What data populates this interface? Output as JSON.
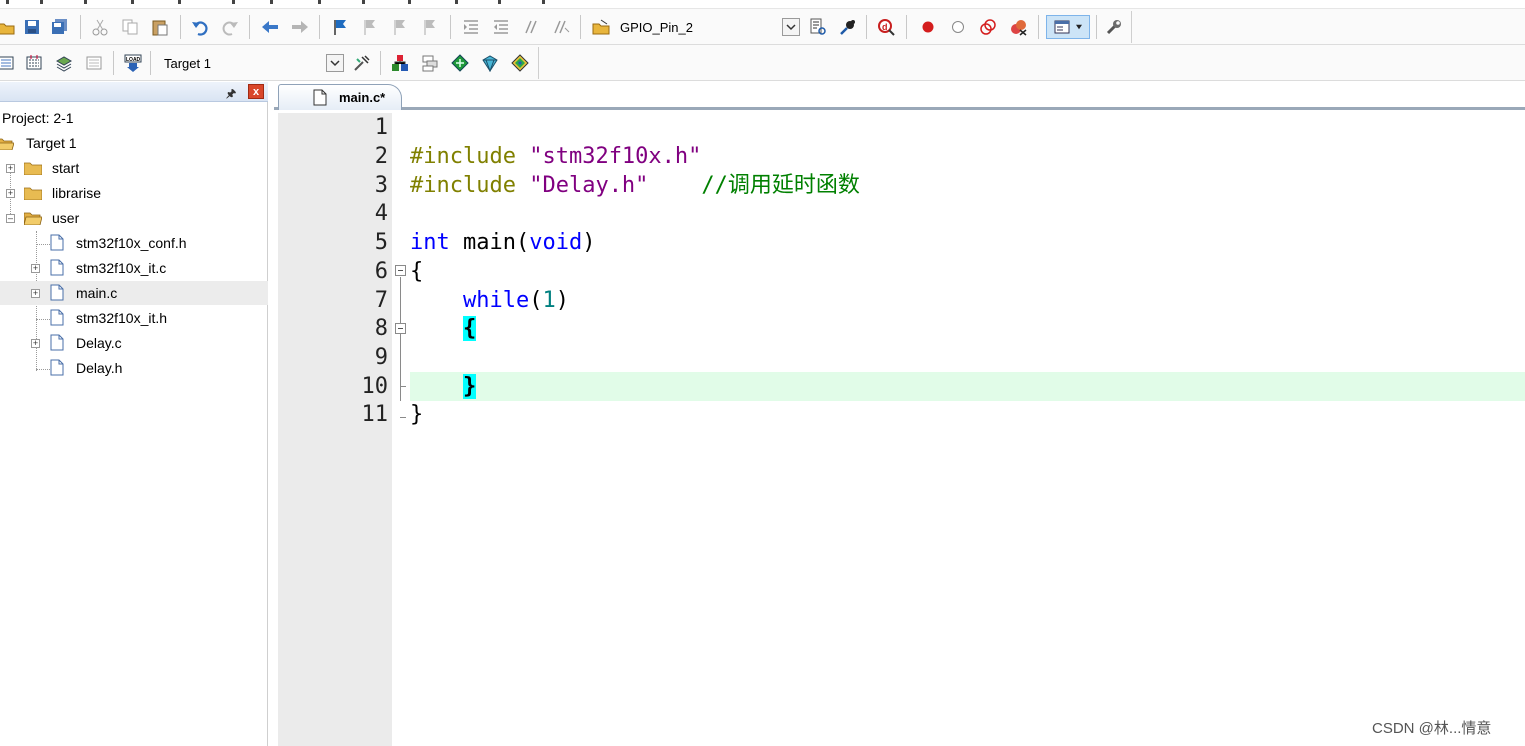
{
  "toolbar1": {
    "target_combo_value": "GPIO_Pin_2",
    "icons": [
      "open-icon",
      "save-icon",
      "save-all-icon",
      "cut-icon",
      "copy-icon",
      "paste-icon",
      "undo-icon",
      "redo-icon",
      "nav-back-icon",
      "nav-forward-icon",
      "bookmark-icon",
      "bookmark-prev-icon",
      "bookmark-next-icon",
      "bookmark-clear-icon",
      "indent-icon",
      "unindent-icon",
      "comment-icon",
      "uncomment-icon",
      "find-in-files-icon",
      "find-icon",
      "incremental-find-icon",
      "debug-icon",
      "breakpoint-icon",
      "breakpoint-disable-icon",
      "breakpoint-disable-all-icon",
      "breakpoint-kill-icon",
      "window-layout-icon",
      "configure-icon"
    ]
  },
  "toolbar2": {
    "target_select_value": "Target 1",
    "load_label": "LOAD",
    "icons": [
      "translate-icon",
      "build-icon",
      "rebuild-icon",
      "batch-build-icon",
      "download-icon",
      "target-options-icon",
      "manage-project-icon",
      "manage-books-icon",
      "pack-installer-icon",
      "select-packs-icon",
      "run-time-env-icon"
    ]
  },
  "project_panel": {
    "close_label": "x",
    "project_label": "Project: 2-1",
    "target_label": "Target 1",
    "groups": [
      {
        "label": "start",
        "expanded": false
      },
      {
        "label": "librarise",
        "expanded": false
      },
      {
        "label": "user",
        "expanded": true
      }
    ],
    "files": [
      {
        "label": "stm32f10x_conf.h",
        "has_children": false
      },
      {
        "label": "stm32f10x_it.c",
        "has_children": true
      },
      {
        "label": "main.c",
        "has_children": true,
        "selected": true
      },
      {
        "label": "stm32f10x_it.h",
        "has_children": false
      },
      {
        "label": "Delay.c",
        "has_children": true
      },
      {
        "label": "Delay.h",
        "has_children": false
      }
    ]
  },
  "editor": {
    "active_tab": "main.c*",
    "line_numbers": [
      "1",
      "2",
      "3",
      "4",
      "5",
      "6",
      "7",
      "8",
      "9",
      "10",
      "11"
    ],
    "lines": {
      "l2_pp": "#include",
      "l2_str": "\"stm32f10x.h\"",
      "l3_pp": "#include",
      "l3_str": "\"Delay.h\"",
      "l3_cmt": "//调用延时函数",
      "l5_kw1": "int",
      "l5_mid": "main(",
      "l5_kw2": "void",
      "l5_end": ")",
      "l6": "{",
      "l7_kw": "while",
      "l7_open": "(",
      "l7_num": "1",
      "l7_close": ")",
      "l8_brace": "{",
      "l10_brace": "}",
      "l11": "}"
    },
    "highlighted_line": "10"
  },
  "watermark": "CSDN @林...情意"
}
